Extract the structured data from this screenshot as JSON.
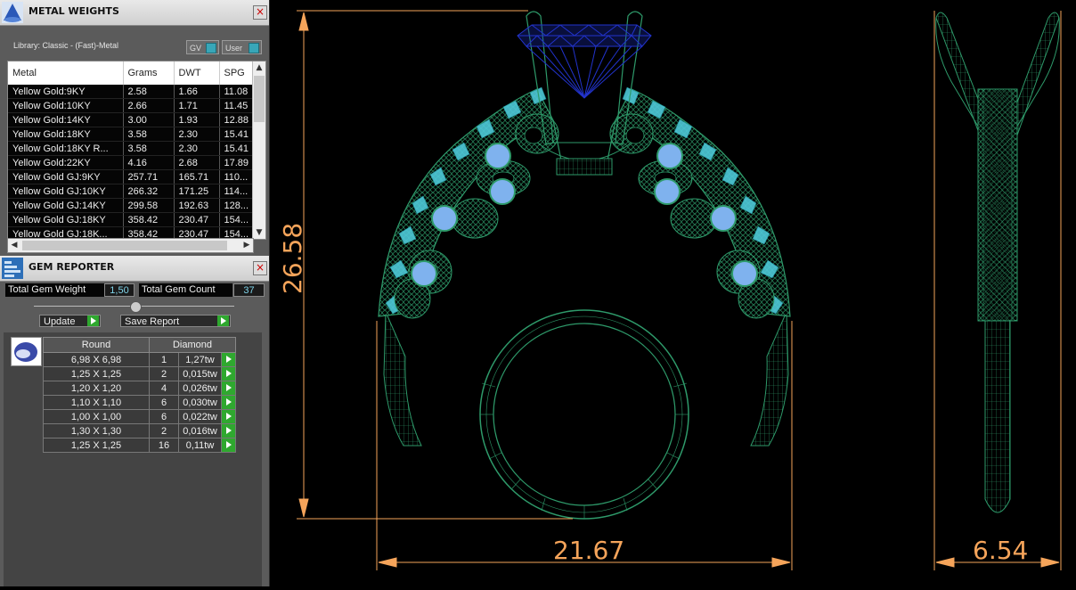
{
  "metal_weights": {
    "title": "METAL WEIGHTS",
    "library_label": "Library: Classic - (Fast)-Metal",
    "toggle_gv": "GV",
    "toggle_user": "User",
    "columns": [
      "Metal",
      "Grams",
      "DWT",
      "SPG"
    ],
    "rows": [
      [
        "Yellow Gold:9KY",
        "2.58",
        "1.66",
        "11.08"
      ],
      [
        "Yellow Gold:10KY",
        "2.66",
        "1.71",
        "11.45"
      ],
      [
        "Yellow Gold:14KY",
        "3.00",
        "1.93",
        "12.88"
      ],
      [
        "Yellow Gold:18KY",
        "3.58",
        "2.30",
        "15.41"
      ],
      [
        "Yellow Gold:18KY R...",
        "3.58",
        "2.30",
        "15.41"
      ],
      [
        "Yellow Gold:22KY",
        "4.16",
        "2.68",
        "17.89"
      ],
      [
        "Yellow Gold GJ:9KY",
        "257.71",
        "165.71",
        "110..."
      ],
      [
        "Yellow Gold GJ:10KY",
        "266.32",
        "171.25",
        "114..."
      ],
      [
        "Yellow Gold GJ:14KY",
        "299.58",
        "192.63",
        "128..."
      ],
      [
        "Yellow Gold GJ:18KY",
        "358.42",
        "230.47",
        "154..."
      ],
      [
        "Yellow Gold GJ:18K...",
        "358.42",
        "230.47",
        "154..."
      ]
    ]
  },
  "gem_reporter": {
    "title": "GEM REPORTER",
    "total_weight_label": "Total Gem Weight",
    "total_weight_value": "1,50",
    "total_count_label": "Total Gem Count",
    "total_count_value": "37",
    "update_label": "Update",
    "save_report_label": "Save Report",
    "headers": [
      "Round",
      "Diamond"
    ],
    "rows": [
      [
        "6,98 X 6,98",
        "1",
        "1,27tw"
      ],
      [
        "1,25 X 1,25",
        "2",
        "0,015tw"
      ],
      [
        "1,20 X 1,20",
        "4",
        "0,026tw"
      ],
      [
        "1,10 X 1,10",
        "6",
        "0,030tw"
      ],
      [
        "1,00 X 1,00",
        "6",
        "0,022tw"
      ],
      [
        "1,30 X 1,30",
        "2",
        "0,016tw"
      ],
      [
        "1,25 X 1,25",
        "16",
        "0,11tw"
      ]
    ]
  },
  "cad": {
    "height_dim": "26.58",
    "width_dim": "21.67",
    "side_width_dim": "6.54",
    "colors": {
      "dimension": "#f5a45a",
      "metal": "#2e9a6a",
      "center_stone": "#2233cc",
      "side_stones": "#7fb2ee",
      "pave": "#4ec9d8"
    }
  }
}
